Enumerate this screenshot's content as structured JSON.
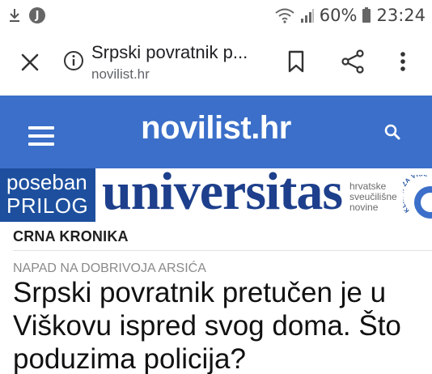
{
  "status_bar": {
    "battery": "60%",
    "time": "23:24",
    "icons": [
      "download-icon",
      "j-app-icon",
      "wifi-icon",
      "signal-icon",
      "battery-icon"
    ],
    "j_label": "J"
  },
  "browser": {
    "page_title": "Srpski povratnik p...",
    "host": "novilist.hr",
    "icons": [
      "close-icon",
      "info-icon",
      "bookmark-icon",
      "share-icon",
      "more-icon"
    ]
  },
  "site": {
    "logo": "novilist.hr",
    "header_color": "#3b6fc9",
    "icons": [
      "hamburger-menu-icon",
      "search-icon"
    ]
  },
  "banner": {
    "poseban": "poseban",
    "prilog": "PRILOG",
    "universitas": "universitas",
    "hrv_line1": "hrvatske",
    "hrv_line2": "sveučilišne",
    "hrv_line3": "novine",
    "klik": "KLIKNI ZA VIŠE",
    "poseban_color": "#1d4f9e",
    "brand_color": "#1d3f8c"
  },
  "article": {
    "category": "CRNA KRONIKA",
    "kicker": "NAPAD NA DOBRIVOJA ARSIĆA",
    "headline": "Srpski povratnik pretučen je u Viškovu ispred svog doma. Što poduzima policija?"
  }
}
